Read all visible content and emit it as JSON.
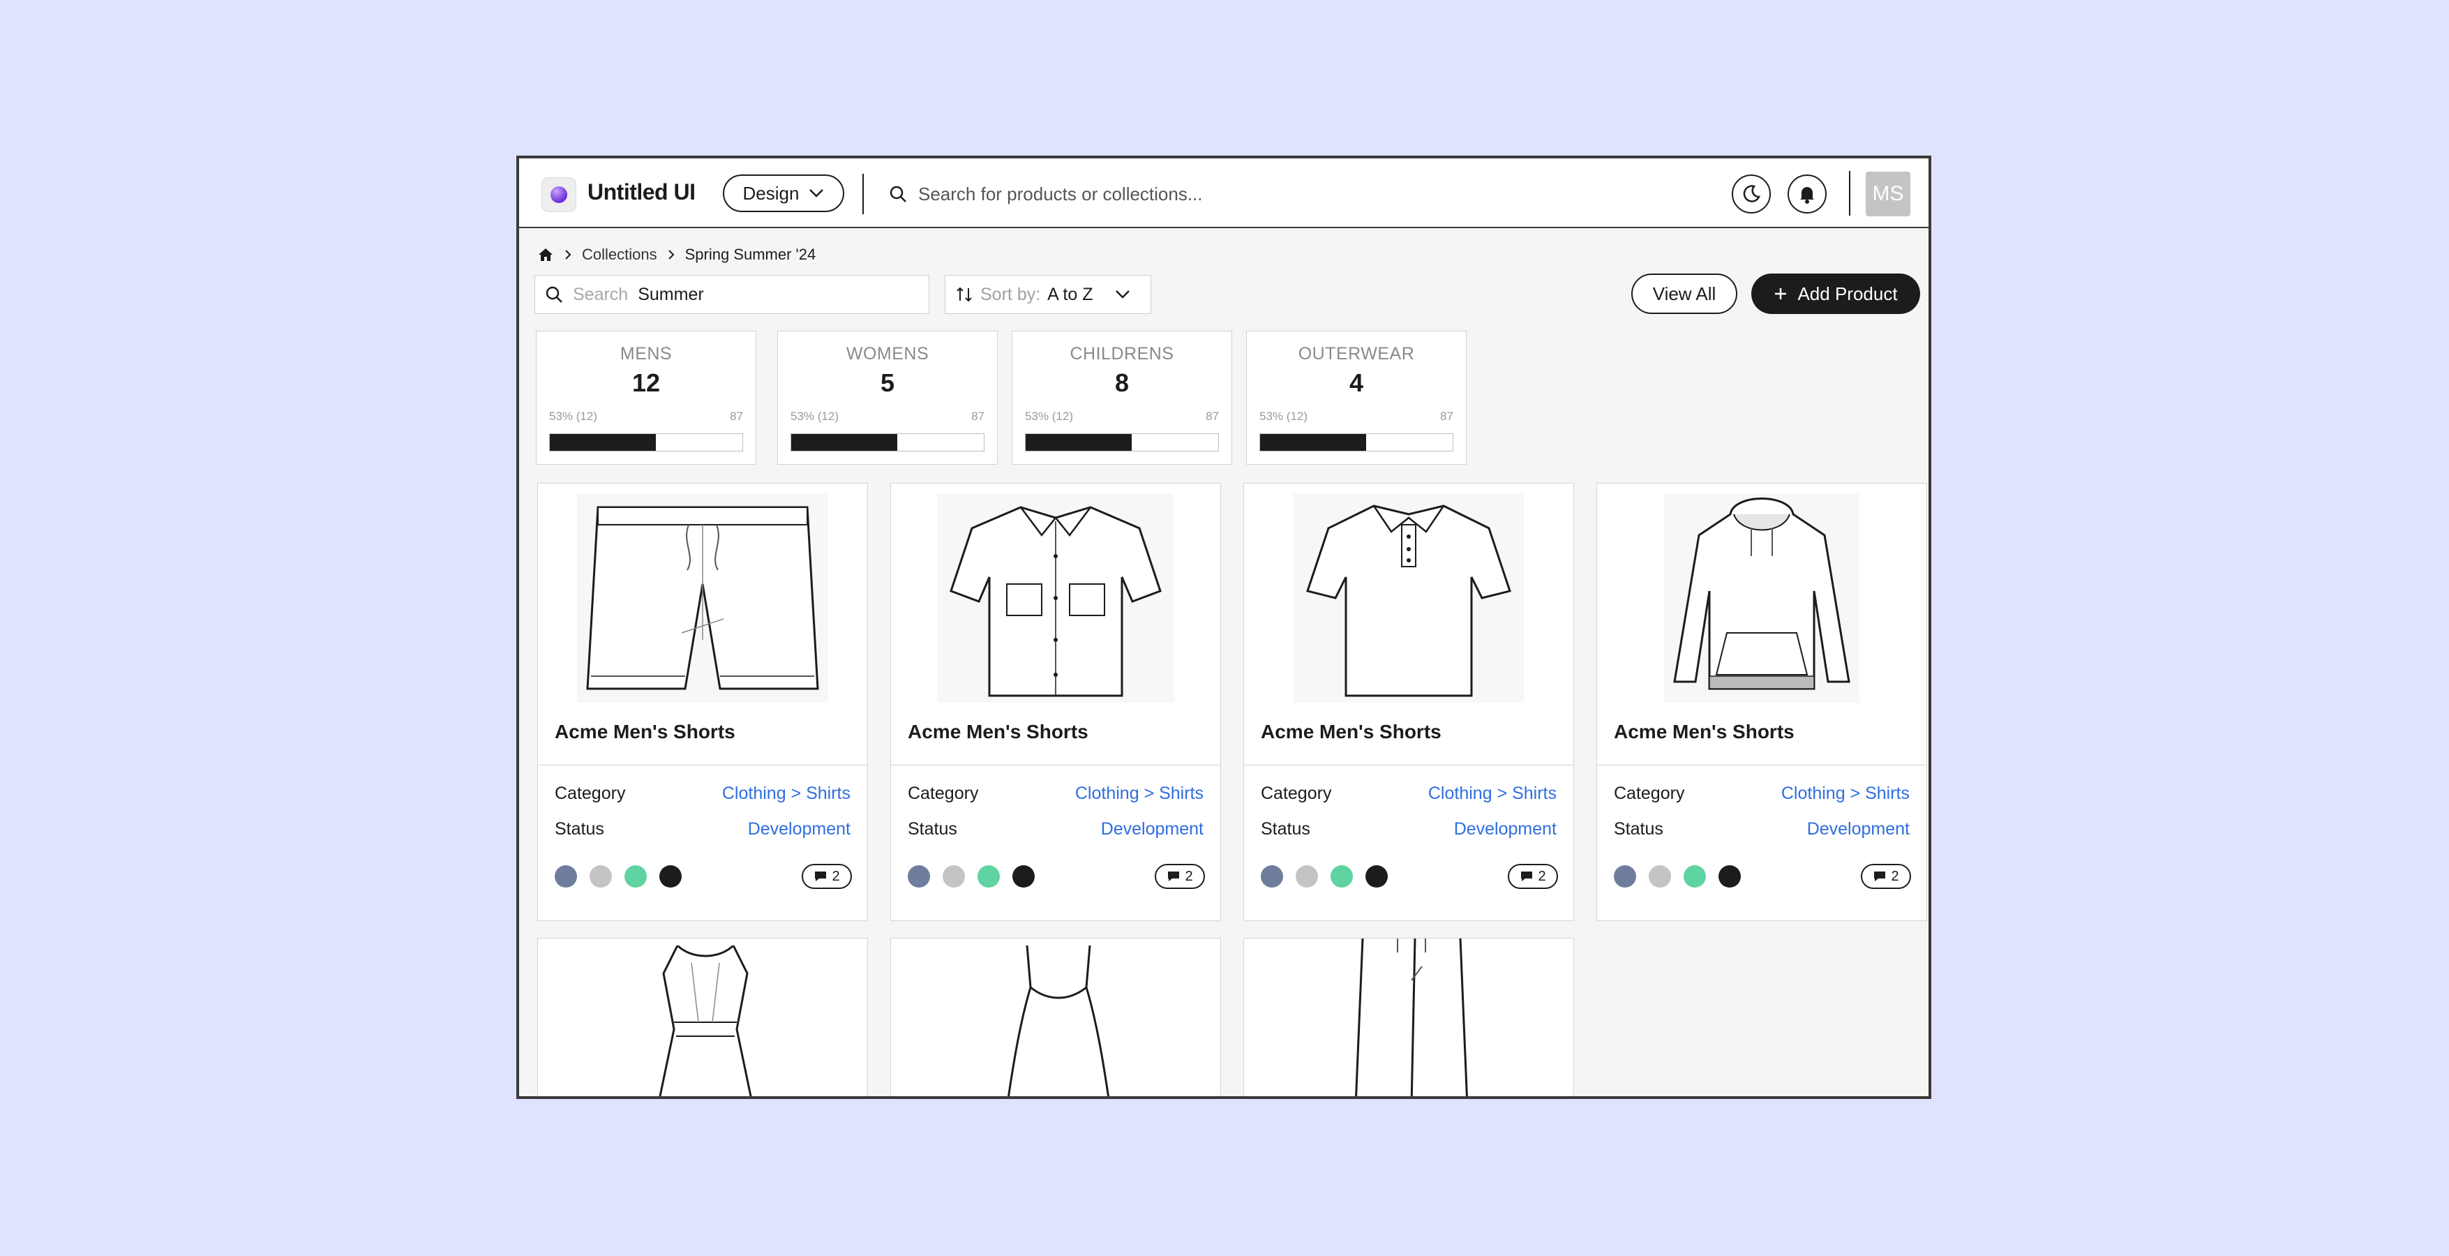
{
  "header": {
    "app_title": "Untitled UI",
    "workspace": "Design",
    "search_placeholder": "Search for products or collections...",
    "avatar_initials": "MS"
  },
  "breadcrumb": {
    "items": [
      "Collections",
      "Spring Summer '24"
    ]
  },
  "filters": {
    "search_placeholder": "Search",
    "search_value": "Summer",
    "sort_label": "Sort by:",
    "sort_value": "A to Z",
    "view_all": "View All",
    "add_product": "Add Product"
  },
  "stats": [
    {
      "category": "MENS",
      "count": "12",
      "progress_label": "53% (12)",
      "total": "87",
      "progress": 0.55
    },
    {
      "category": "WOMENS",
      "count": "5",
      "progress_label": "53% (12)",
      "total": "87",
      "progress": 0.55
    },
    {
      "category": "CHILDRENS",
      "count": "8",
      "progress_label": "53% (12)",
      "total": "87",
      "progress": 0.55
    },
    {
      "category": "OUTERWEAR",
      "count": "4",
      "progress_label": "53% (12)",
      "total": "87",
      "progress": 0.55
    }
  ],
  "products": [
    {
      "name": "Acme Men's Shorts",
      "category_label": "Category",
      "category": "Clothing > Shirts",
      "status_label": "Status",
      "status": "Development",
      "comments": "2",
      "image": "shorts"
    },
    {
      "name": "Acme Men's Shorts",
      "category_label": "Category",
      "category": "Clothing > Shirts",
      "status_label": "Status",
      "status": "Development",
      "comments": "2",
      "image": "button-shirt"
    },
    {
      "name": "Acme Men's Shorts",
      "category_label": "Category",
      "category": "Clothing > Shirts",
      "status_label": "Status",
      "status": "Development",
      "comments": "2",
      "image": "polo-shirt"
    },
    {
      "name": "Acme Men's Shorts",
      "category_label": "Category",
      "category": "Clothing > Shirts",
      "status_label": "Status",
      "status": "Development",
      "comments": "2",
      "image": "hoodie"
    }
  ],
  "partial_products": [
    "dress",
    "tank-top",
    "trousers"
  ],
  "swatch_colors": [
    "#6f7d9c",
    "#c4c4c4",
    "#5fd3a1",
    "#1c1c1c"
  ],
  "colors": {
    "background": "#e0e3fe",
    "accent_link": "#2f6ee0",
    "primary": "#1c1c1c"
  }
}
